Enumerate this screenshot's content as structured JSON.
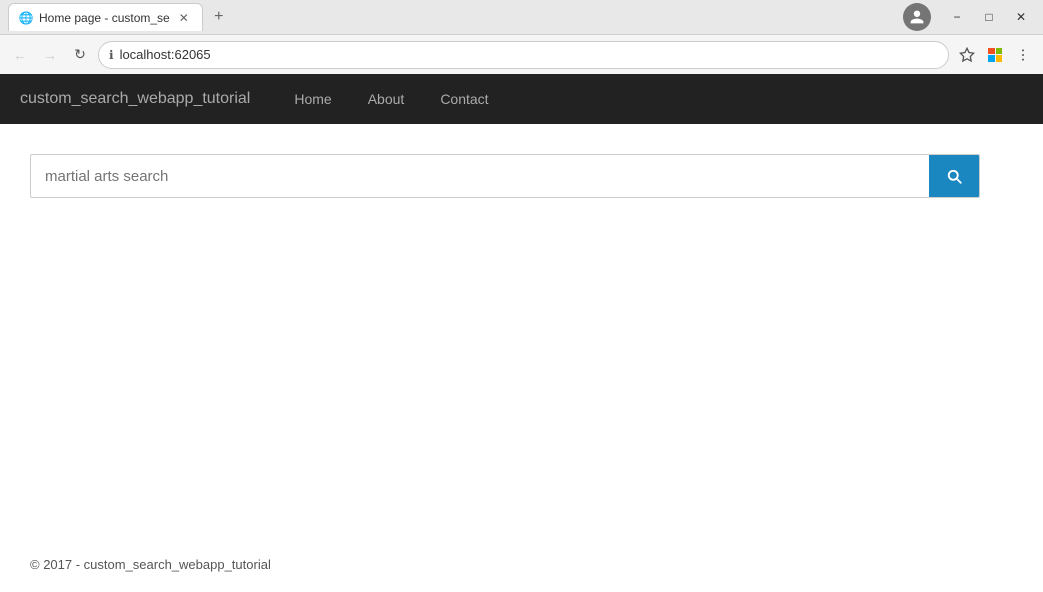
{
  "browser": {
    "tab": {
      "title": "Home page - custom_se",
      "favicon": "🌐"
    },
    "new_tab_label": "+",
    "address": "localhost:62065",
    "address_placeholder": "localhost:62065",
    "window_controls": {
      "minimize": "−",
      "maximize": "□",
      "close": "✕"
    }
  },
  "navbar": {
    "brand": "custom_search_webapp_tutorial",
    "links": [
      {
        "label": "Home",
        "id": "home"
      },
      {
        "label": "About",
        "id": "about"
      },
      {
        "label": "Contact",
        "id": "contact"
      }
    ]
  },
  "search": {
    "placeholder": "martial arts search",
    "button_icon": "🔍"
  },
  "footer": {
    "text": "© 2017 - custom_search_webapp_tutorial"
  }
}
